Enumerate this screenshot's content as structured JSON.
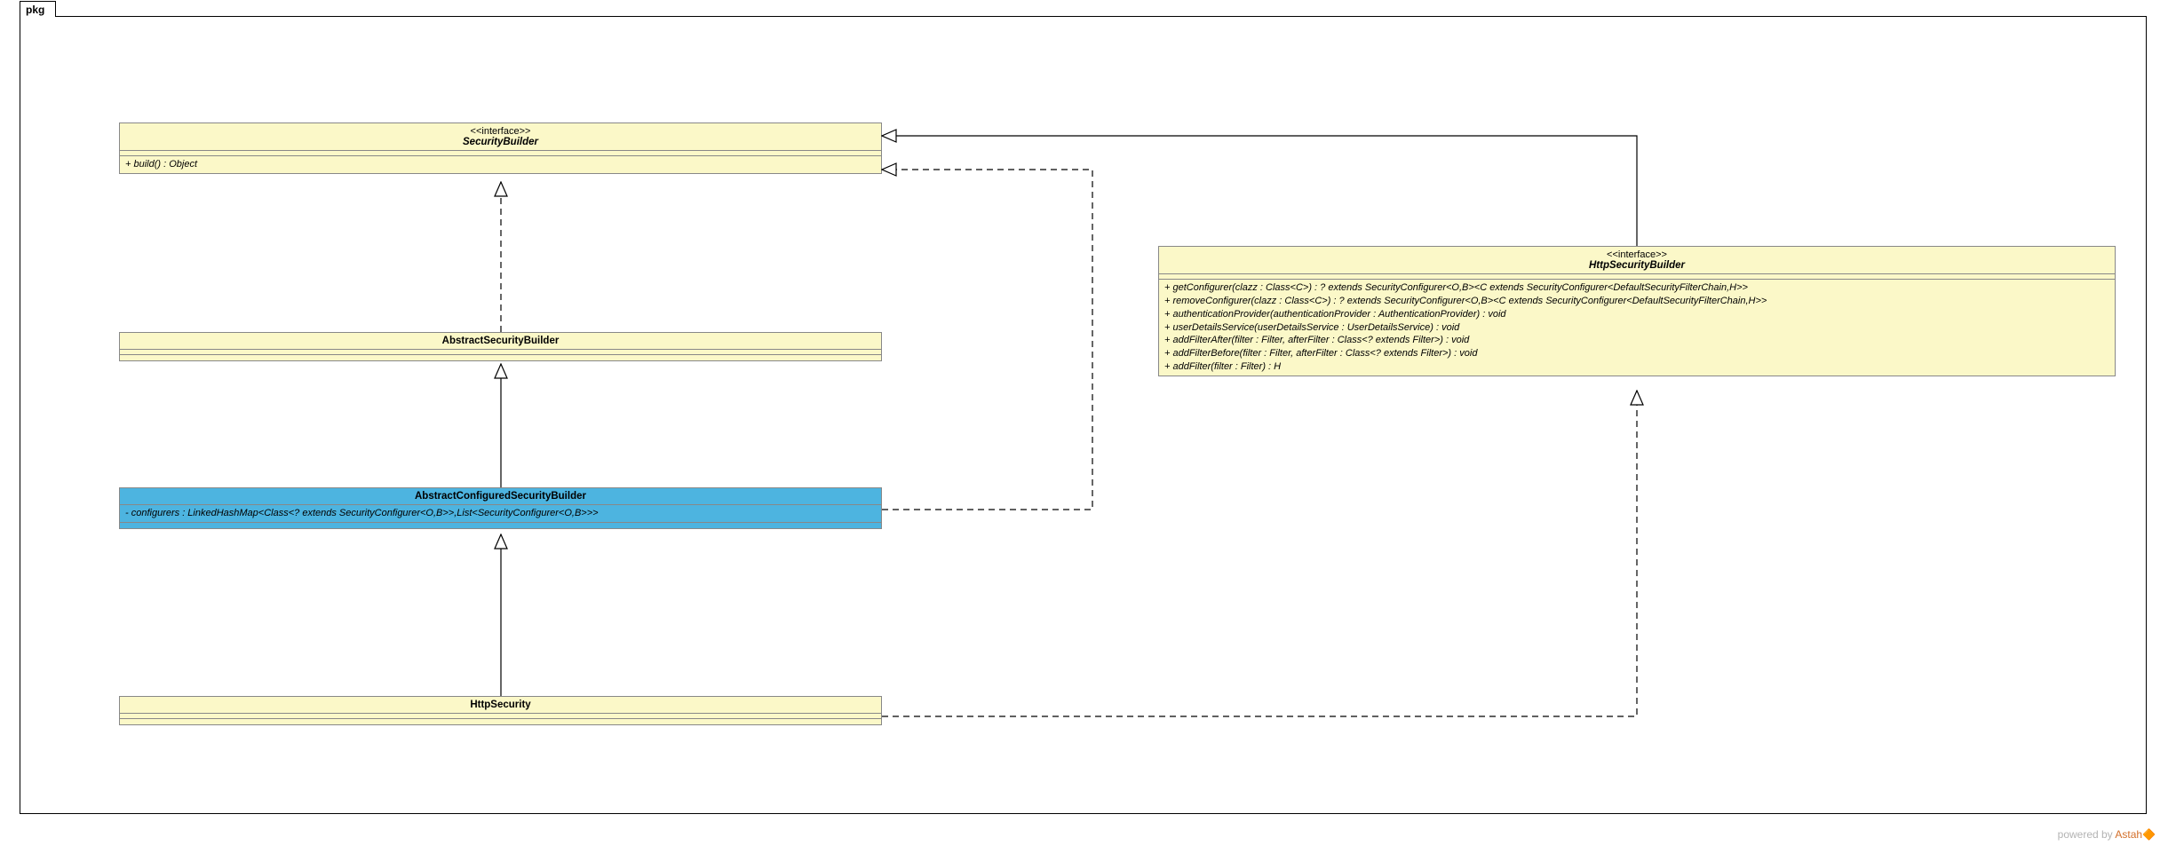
{
  "package": {
    "label": "pkg"
  },
  "footer": {
    "prefix": "powered by ",
    "brand": "Astah",
    "icon": "🔶"
  },
  "classes": {
    "securityBuilder": {
      "stereotype": "<<interface>>",
      "name": "SecurityBuilder",
      "ops": [
        "+ build() : Object"
      ]
    },
    "abstractSecurityBuilder": {
      "name": "AbstractSecurityBuilder"
    },
    "abstractConfiguredSecurityBuilder": {
      "name": "AbstractConfiguredSecurityBuilder",
      "attrs": [
        "- configurers : LinkedHashMap<Class<? extends SecurityConfigurer<O,B>>,List<SecurityConfigurer<O,B>>>"
      ]
    },
    "httpSecurity": {
      "name": "HttpSecurity"
    },
    "httpSecurityBuilder": {
      "stereotype": "<<interface>>",
      "name": "HttpSecurityBuilder",
      "ops": [
        "+ getConfigurer(clazz : Class<C>) : ? extends SecurityConfigurer<O,B><C extends SecurityConfigurer<DefaultSecurityFilterChain,H>>",
        "+ removeConfigurer(clazz : Class<C>) : ? extends SecurityConfigurer<O,B><C extends SecurityConfigurer<DefaultSecurityFilterChain,H>>",
        "+ authenticationProvider(authenticationProvider : AuthenticationProvider) : void",
        "+ userDetailsService(userDetailsService : UserDetailsService) : void",
        "+ addFilterAfter(filter : Filter, afterFilter : Class<? extends Filter>) : void",
        "+ addFilterBefore(filter : Filter, afterFilter : Class<? extends Filter>) : void",
        "+ addFilter(filter : Filter) : H"
      ]
    }
  }
}
